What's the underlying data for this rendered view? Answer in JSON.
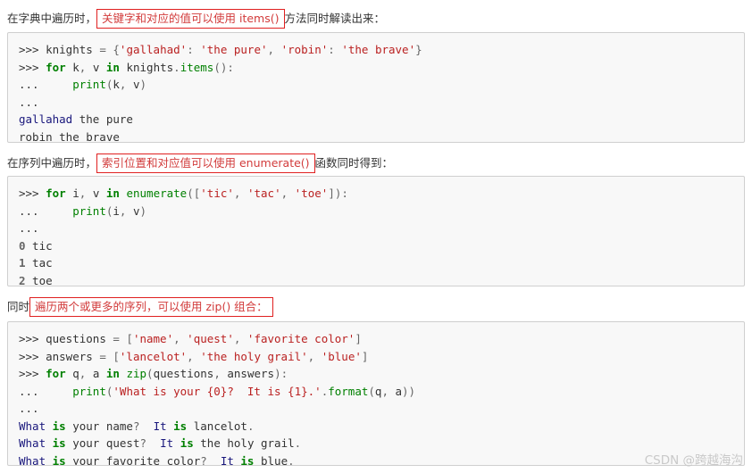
{
  "document": {
    "paragraphs": [
      {
        "id": "p1",
        "lead": "在字典中遍历时，",
        "highlight": "关键字和对应的值可以使用 items()",
        "tail": "方法同时解读出来："
      },
      {
        "id": "p2",
        "lead": "在序列中遍历时，",
        "highlight": "索引位置和对应值可以使用 enumerate()",
        "tail": "函数同时得到："
      },
      {
        "id": "p3",
        "lead": "同时",
        "highlight": "遍历两个或更多的序列，可以使用 zip() 组合：",
        "tail": ""
      }
    ],
    "code_blocks": [
      {
        "id": "cb1",
        "lines": [
          ">>> knights = {'gallahad': 'the pure', 'robin': 'the brave'}",
          ">>> for k, v in knights.items():",
          "...     print(k, v)",
          "...",
          "gallahad the pure",
          "robin the brave"
        ]
      },
      {
        "id": "cb2",
        "lines": [
          ">>> for i, v in enumerate(['tic', 'tac', 'toe']):",
          "...     print(i, v)",
          "...",
          "0 tic",
          "1 tac",
          "2 toe"
        ]
      },
      {
        "id": "cb3",
        "lines": [
          ">>> questions = ['name', 'quest', 'favorite color']",
          ">>> answers = ['lancelot', 'the holy grail', 'blue']",
          ">>> for q, a in zip(questions, answers):",
          "...     print('What is your {0}?  It is {1}.'.format(q, a))",
          "...",
          "What is your name?  It is lancelot.",
          "What is your quest?  It is the holy grail.",
          "What is your favorite color?  It is blue."
        ]
      }
    ],
    "watermark": "CSDN @跨越海沟",
    "colors": {
      "highlight_border": "#e02020",
      "code_background": "#f8f8f8",
      "code_border": "#cfcfcf",
      "keyword": "#008000",
      "string": "#ba2121",
      "name": "#19177c",
      "watermark": "#c9c9c9"
    }
  }
}
